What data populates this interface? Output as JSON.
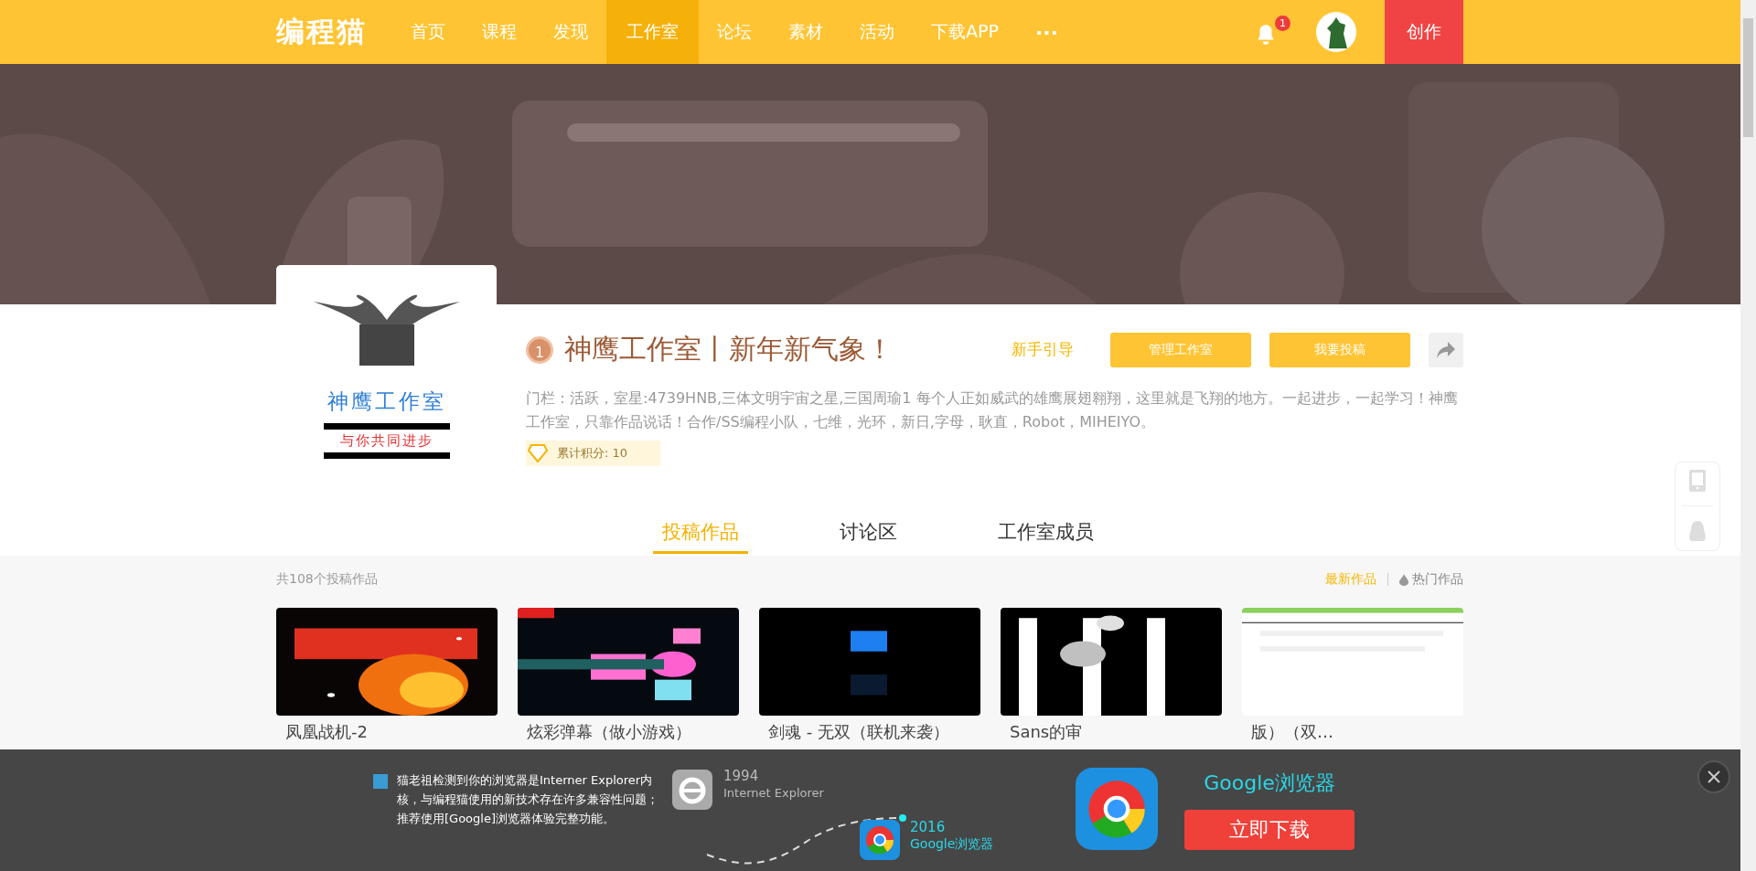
{
  "nav": {
    "logo": "编程猫",
    "items": [
      {
        "label": "首页",
        "selected": false
      },
      {
        "label": "课程",
        "selected": false
      },
      {
        "label": "发现",
        "selected": false
      },
      {
        "label": "工作室",
        "selected": true
      },
      {
        "label": "论坛",
        "selected": false
      },
      {
        "label": "素材",
        "selected": false
      },
      {
        "label": "活动",
        "selected": false
      },
      {
        "label": "下载APP",
        "selected": false
      }
    ],
    "more": "···",
    "notification_count": "1",
    "create_button": "创作"
  },
  "studio": {
    "logo_title": "神鹰工作室",
    "logo_slogan": "与你共同进步",
    "level_badge": "1",
    "name": "神鹰工作室丨新年新气象！",
    "guide_link": "新手引导",
    "buttons": [
      "管理工作室",
      "我要投稿"
    ],
    "description": "门栏：活跃，室星:4739HNB,三体文明宇宙之星,三国周瑜1 每个人正如威武的雄鹰展翅翱翔，这里就是飞翔的地方。一起进步，一起学习！神鹰工作室，只靠作品说话！合作/SS编程小队，七维，光环，新日,字母，耿直，Robot，MIHEIYO。",
    "points": "累计积分: 10"
  },
  "tabs": [
    {
      "label": "投稿作品",
      "selected": true
    },
    {
      "label": "讨论区",
      "selected": false
    },
    {
      "label": "工作室成员",
      "selected": false
    }
  ],
  "works": {
    "count": "共108个投稿作品",
    "sort": [
      {
        "label": "最新作品",
        "selected": true
      },
      {
        "label": "热门作品",
        "selected": false
      }
    ],
    "items": [
      {
        "title": "凤凰战机-2",
        "kind": "picture"
      },
      {
        "title": "炫彩弹幕（做小游戏）",
        "kind": "picture"
      },
      {
        "title": "剑魂 - 无双（联机来袭）",
        "kind": "picture"
      },
      {
        "title": "Sans的审",
        "kind": "picture"
      },
      {
        "title": "版）（双…",
        "kind": "picture"
      }
    ]
  },
  "browser_notice": {
    "checked": true,
    "message": "猫老祖检测到你的浏览器是Interner Explorer内核，与编程猫使用的新技术存在许多兼容性问题；推荐使用[Google]浏览器体验完整功能。",
    "old_year": "1994",
    "old_name": "Internet Explorer",
    "new_year": "2016",
    "new_name": "Google浏览器",
    "browser_title": "Google浏览器",
    "download_button": "立即下载"
  }
}
